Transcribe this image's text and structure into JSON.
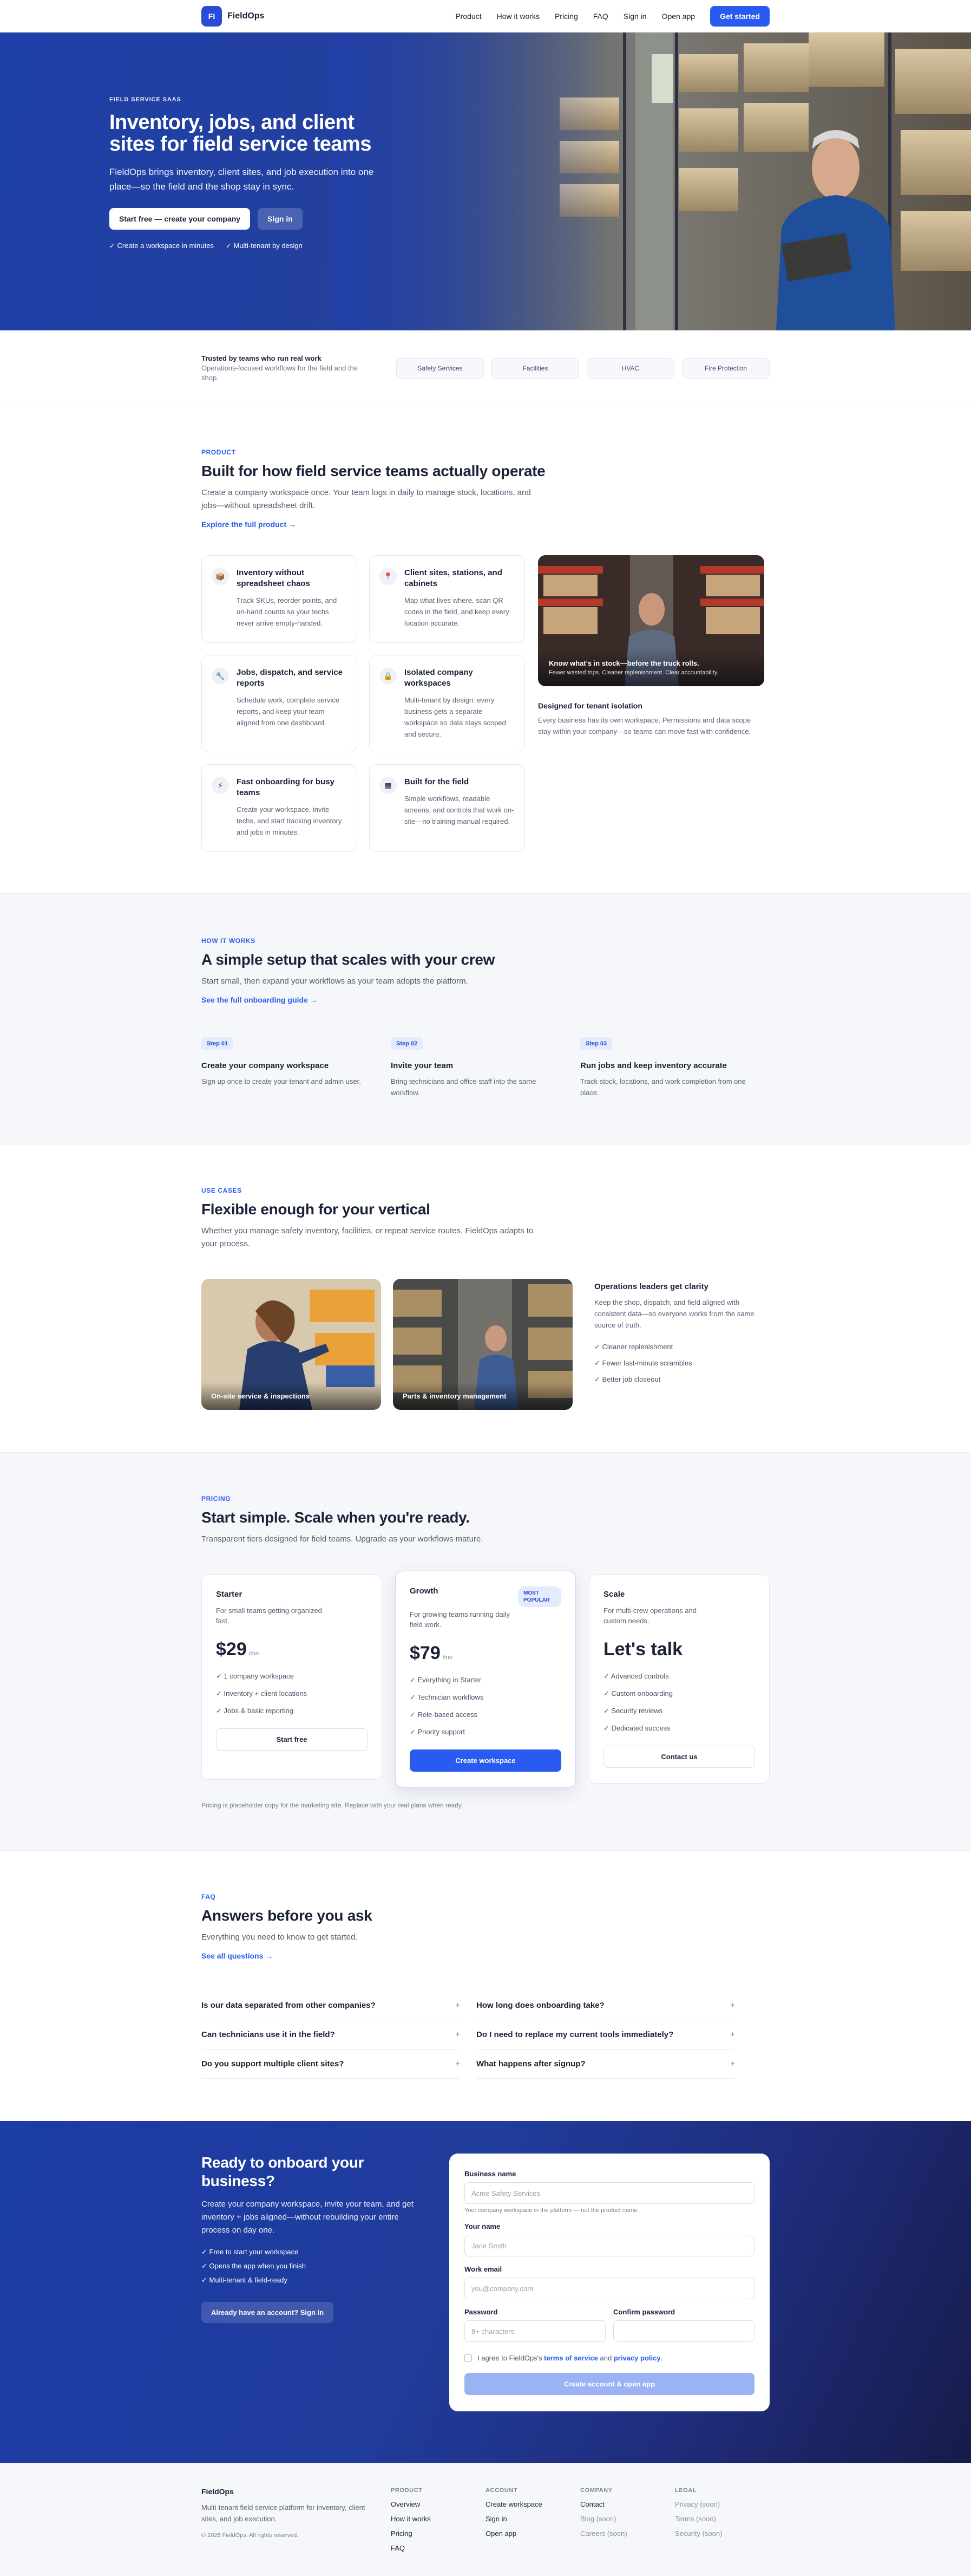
{
  "nav": {
    "logo_mark": "FI",
    "brand": "FieldOps",
    "links": [
      "Product",
      "How it works",
      "Pricing",
      "FAQ",
      "Sign in",
      "Open app"
    ],
    "cta": "Get started"
  },
  "hero": {
    "eyebrow": "FIELD SERVICE SAAS",
    "title": "Inventory, jobs, and client sites for field service teams",
    "subtitle": "FieldOps brings inventory, client sites, and job execution into one place—so the field and the shop stay in sync.",
    "primary_cta": "Start free — create your company",
    "secondary_cta": "Sign in",
    "checks": [
      "✓ Create a workspace in minutes",
      "✓ Multi-tenant by design"
    ]
  },
  "trust": {
    "title": "Trusted by teams who run real work",
    "subtitle": "Operations-focused workflows for the field and the shop.",
    "pills": [
      "Safety Services",
      "Facilities",
      "HVAC",
      "Fire Protection"
    ]
  },
  "product": {
    "eyebrow": "PRODUCT",
    "title": "Built for how field service teams actually operate",
    "lead": "Create a company workspace once. Your team logs in daily to manage stock, locations, and jobs—without spreadsheet drift.",
    "link": "Explore the full product →",
    "cards": [
      {
        "icon": "📦",
        "title": "Inventory without spreadsheet chaos",
        "text": "Track SKUs, reorder points, and on-hand counts so your techs never arrive empty-handed."
      },
      {
        "icon": "📍",
        "title": "Client sites, stations, and cabinets",
        "text": "Map what lives where, scan QR codes in the field, and keep every location accurate."
      },
      {
        "icon": "🔧",
        "title": "Jobs, dispatch, and service reports",
        "text": "Schedule work, complete service reports, and keep your team aligned from one dashboard."
      },
      {
        "icon": "🔒",
        "title": "Isolated company workspaces",
        "text": "Multi-tenant by design: every business gets a separate workspace so data stays scoped and secure."
      },
      {
        "icon": "⚡",
        "title": "Fast onboarding for busy teams",
        "text": "Create your workspace, invite techs, and start tracking inventory and jobs in minutes."
      },
      {
        "icon": "▦",
        "title": "Built for the field",
        "text": "Simple workflows, readable screens, and controls that work on-site—no training manual required."
      }
    ],
    "photo_caption": "Know what's in stock—before the truck rolls.",
    "photo_sub": "Fewer wasted trips. Cleaner replenishment. Clear accountability.",
    "iso_title": "Designed for tenant isolation",
    "iso_text": "Every business has its own workspace. Permissions and data scope stay within your company—so teams can move fast with confidence."
  },
  "how": {
    "eyebrow": "HOW IT WORKS",
    "title": "A simple setup that scales with your crew",
    "lead": "Start small, then expand your workflows as your team adopts the platform.",
    "link": "See the full onboarding guide →",
    "steps": [
      {
        "badge": "Step 01",
        "title": "Create your company workspace",
        "text": "Sign up once to create your tenant and admin user."
      },
      {
        "badge": "Step 02",
        "title": "Invite your team",
        "text": "Bring technicians and office staff into the same workflow."
      },
      {
        "badge": "Step 03",
        "title": "Run jobs and keep inventory accurate",
        "text": "Track stock, locations, and work completion from one place."
      }
    ]
  },
  "usecases": {
    "eyebrow": "USE CASES",
    "title": "Flexible enough for your vertical",
    "lead": "Whether you manage safety inventory, facilities, or repeat service routes, FieldOps adapts to your process.",
    "photos": [
      "On-site service & inspections",
      "Parts & inventory management"
    ],
    "side_title": "Operations leaders get clarity",
    "side_text": "Keep the shop, dispatch, and field aligned with consistent data—so everyone works from the same source of truth.",
    "checks": [
      "✓ Cleaner replenishment",
      "✓ Fewer last-minute scrambles",
      "✓ Better job closeout"
    ]
  },
  "pricing": {
    "eyebrow": "PRICING",
    "title": "Start simple. Scale when you're ready.",
    "lead": "Transparent tiers designed for field teams. Upgrade as your workflows mature.",
    "plans": [
      {
        "name": "Starter",
        "desc": "For small teams getting organized fast.",
        "price": "$29",
        "per": "/mo",
        "features": [
          "✓ 1 company workspace",
          "✓ Inventory + client locations",
          "✓ Jobs & basic reporting"
        ],
        "cta": "Start free"
      },
      {
        "name": "Growth",
        "badge": "MOST POPULAR",
        "desc": "For growing teams running daily field work.",
        "price": "$79",
        "per": "/mo",
        "features": [
          "✓ Everything in Starter",
          "✓ Technician workflows",
          "✓ Role-based access",
          "✓ Priority support"
        ],
        "cta": "Create workspace"
      },
      {
        "name": "Scale",
        "desc": "For multi-crew operations and custom needs.",
        "price": "Let's talk",
        "features": [
          "✓ Advanced controls",
          "✓ Custom onboarding",
          "✓ Security reviews",
          "✓ Dedicated success"
        ],
        "cta": "Contact us"
      }
    ],
    "note": "Pricing is placeholder copy for the marketing site. Replace with your real plans when ready."
  },
  "faq": {
    "eyebrow": "FAQ",
    "title": "Answers before you ask",
    "lead": "Everything you need to know to get started.",
    "link": "See all questions →",
    "items": [
      "Is our data separated from other companies?",
      "How long does onboarding take?",
      "Can technicians use it in the field?",
      "Do I need to replace my current tools immediately?",
      "Do you support multiple client sites?",
      "What happens after signup?"
    ],
    "expand": "+"
  },
  "cta": {
    "title": "Ready to onboard your business?",
    "text": "Create your company workspace, invite your team, and get inventory + jobs aligned—without rebuilding your entire process on day one.",
    "checks": [
      "✓ Free to start your workspace",
      "✓ Opens the app when you finish",
      "✓ Multi-tenant & field-ready"
    ],
    "signin": "Already have an account? Sign in",
    "form": {
      "business_label": "Business name",
      "business_ph": "Acme Safety Services",
      "business_hint": "Your company workspace in the platform — not the product name.",
      "name_label": "Your name",
      "name_ph": "Jane Smith",
      "email_label": "Work email",
      "email_ph": "you@company.com",
      "pw_label": "Password",
      "pw_ph": "8+ characters",
      "confirm_label": "Confirm password",
      "agree_pre": "I agree to FieldOps's",
      "terms": "terms of service",
      "and": "and",
      "privacy": "privacy policy",
      "period": ".",
      "submit": "Create account & open app"
    }
  },
  "footer": {
    "brand": "FieldOps",
    "desc": "Multi-tenant field service platform for inventory, client sites, and job execution.",
    "copy": "© 2026 FieldOps. All rights reserved.",
    "cols": [
      {
        "title": "PRODUCT",
        "links": [
          "Overview",
          "How it works",
          "Pricing",
          "FAQ"
        ]
      },
      {
        "title": "ACCOUNT",
        "links": [
          "Create workspace",
          "Sign in",
          "Open app"
        ]
      },
      {
        "title": "COMPANY",
        "links": [
          "Contact",
          "Blog (soon)",
          "Careers (soon)"
        ]
      },
      {
        "title": "LEGAL",
        "links": [
          "Privacy (soon)",
          "Terms (soon)",
          "Security (soon)"
        ]
      }
    ]
  },
  "colors": {
    "primary": "#2a5bf0",
    "hero": "#1e3fa8",
    "cta_dark": "#151c4a"
  }
}
